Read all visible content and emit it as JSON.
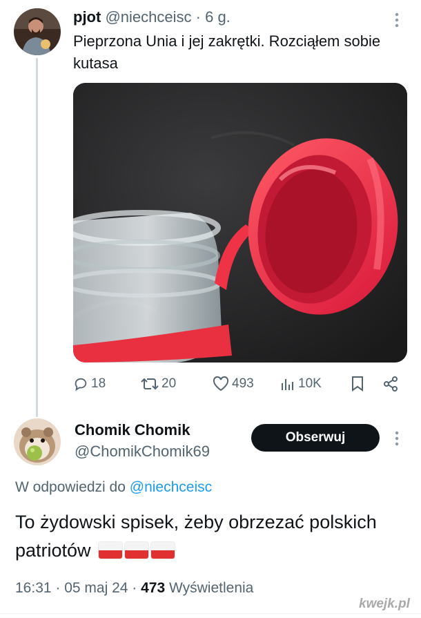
{
  "tweet": {
    "author_name": "pjot",
    "author_handle": "@niechceisc",
    "separator": "·",
    "time": "6 g.",
    "text": "Pieprzona Unia i jej zakrętki. Rozciąłem sobie kutasa",
    "stats": {
      "replies": "18",
      "retweets": "20",
      "likes": "493",
      "views": "10K"
    }
  },
  "reply": {
    "author_name": "Chomik Chomik",
    "author_handle": "@ChomikChomik69",
    "follow_label": "Obserwuj",
    "reply_prefix": "W odpowiedzi do",
    "reply_mention": "@niechceisc",
    "text": "To żydowski spisek, żeby obrzezać polskich patriotów",
    "time": "16:31 · 05 maj 24 ·",
    "views_count": "473",
    "views_label": "Wyświetlenia"
  },
  "watermark": "kwejk.pl",
  "icons": {
    "more": "more-vertical-icon",
    "reply": "reply-icon",
    "retweet": "retweet-icon",
    "like": "heart-icon",
    "views": "analytics-icon",
    "bookmark": "bookmark-icon",
    "share": "share-icon"
  },
  "colors": {
    "text": "#0f1419",
    "secondary": "#536471",
    "accent": "#1d9bf0",
    "button": "#0f1419"
  }
}
